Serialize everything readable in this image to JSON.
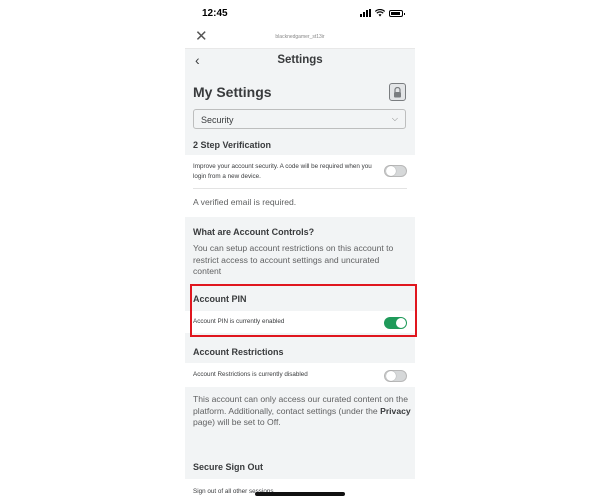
{
  "status_bar": {
    "time": "12:45"
  },
  "browser": {
    "url": "blacknedgamer_st13ir"
  },
  "header": {
    "title": "Settings"
  },
  "page": {
    "title": "My Settings"
  },
  "section_select": {
    "selected": "Security"
  },
  "two_step": {
    "heading": "2 Step Verification",
    "description": "Improve your account security. A code will be required when you login from a new device.",
    "toggle_on": false,
    "note": "A verified email is required."
  },
  "account_controls": {
    "heading": "What are Account Controls?",
    "description": "You can setup account restrictions on this account to restrict access to account settings and uncurated content"
  },
  "account_pin": {
    "heading": "Account PIN",
    "status": "Account PIN is currently enabled",
    "toggle_on": true
  },
  "account_restrictions": {
    "heading": "Account Restrictions",
    "status": "Account Restrictions is currently disabled",
    "toggle_on": false,
    "desc_part1": "This account can only access our curated content on the platform. Additionally, contact settings (under the ",
    "desc_link": "Privacy",
    "desc_part2": " page) will be set to Off."
  },
  "secure_sign_out": {
    "heading": "Secure Sign Out",
    "text": "Sign out of all other sessions"
  },
  "colors": {
    "toggle_on": "#1f9a5a",
    "highlight": "#e0161e",
    "background": "#f2f4f5"
  }
}
